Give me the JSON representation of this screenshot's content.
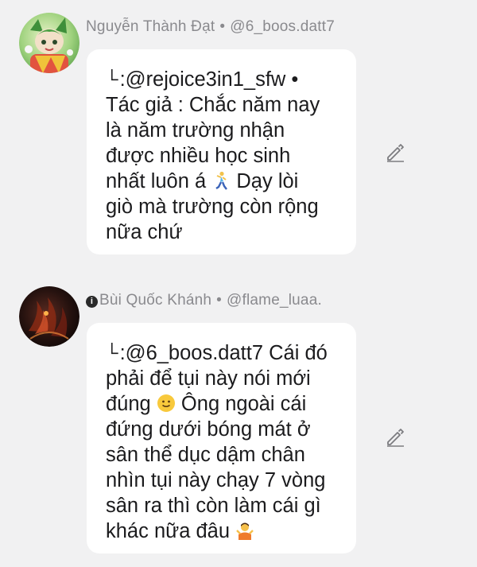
{
  "comments": [
    {
      "author": "Nguyễn Thành Đạt",
      "separator": "•",
      "handle": "@6_boos.datt7",
      "reply_prefix": ":@rejoice3in1_sfw •",
      "lines": [
        "Tác giả : Chắc năm nay",
        "là năm trường nhận",
        "được nhiều học sinh",
        "nhất luôn á",
        "giò mà trường còn rộng",
        "nữa chứ"
      ],
      "line4_tail": "Dạy lòi",
      "emoji_1": "dancing-person-emoji",
      "avatar": "anime-avatar-green",
      "action_icon": "edit-pencil-icon"
    },
    {
      "badge_icon": "info-badge-icon",
      "author": "Bùi Quốc Khánh",
      "separator": "•",
      "handle": "@flame_luaa.",
      "reply_prefix": ":@6_boos.datt7 Cái đó",
      "lines": [
        "phải để tụi này nói mới",
        "đúng",
        "đứng dưới bóng mát ở",
        "sân thể dục dậm chân",
        "nhìn tụi này chạy 7 vòng",
        "sân ra thì còn làm cái gì",
        "khác nữa đâu"
      ],
      "line2_tail": "Ông ngoài cái",
      "emoji_1": "slight-smile-emoji",
      "emoji_2": "shrug-person-emoji",
      "avatar": "dark-fire-avatar",
      "action_icon": "edit-pencil-icon"
    }
  ],
  "colors": {
    "background": "#f1f1f2",
    "bubble": "#ffffff",
    "meta_text": "#8a8a8e",
    "body_text": "#1b1b1d"
  }
}
